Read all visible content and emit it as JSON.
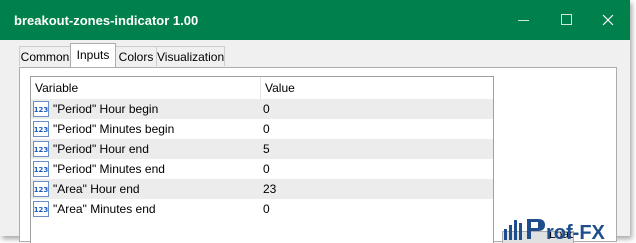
{
  "window": {
    "title": "breakout-zones-indicator 1.00",
    "title_bar_color": "#00804a"
  },
  "tabs": [
    {
      "label": "Common",
      "active": false
    },
    {
      "label": "Inputs",
      "active": true
    },
    {
      "label": "Colors",
      "active": false
    },
    {
      "label": "Visualization",
      "active": false
    }
  ],
  "table": {
    "columns": [
      "Variable",
      "Value"
    ],
    "rows": [
      {
        "icon": "integer-123-icon",
        "variable": "\"Period\" Hour begin",
        "value": "0"
      },
      {
        "icon": "integer-123-icon",
        "variable": "\"Period\" Minutes begin",
        "value": "0"
      },
      {
        "icon": "integer-123-icon",
        "variable": "\"Period\" Hour end",
        "value": "5"
      },
      {
        "icon": "integer-123-icon",
        "variable": "\"Period\" Minutes end",
        "value": "0"
      },
      {
        "icon": "integer-123-icon",
        "variable": "\"Area\" Hour end",
        "value": "23"
      },
      {
        "icon": "integer-123-icon",
        "variable": "\"Area\" Minutes end",
        "value": "0"
      }
    ]
  },
  "side_button": {
    "label": "Load"
  },
  "watermark": {
    "text": "Prof-FX",
    "color": "#1e4f8c"
  }
}
